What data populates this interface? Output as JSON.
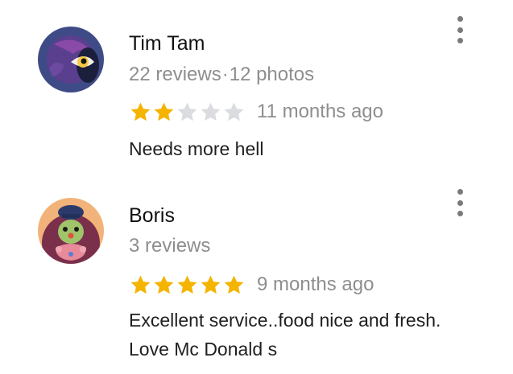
{
  "reviews": [
    {
      "author": "Tim Tam",
      "reviews_count": "22 reviews",
      "separator": "·",
      "photos_count": "12 photos",
      "rating": 2,
      "max_rating": 5,
      "time": "11 months ago",
      "text": "Needs more hell",
      "avatar_icon": "crescent-moon-eye-avatar"
    },
    {
      "author": "Boris",
      "reviews_count": "3 reviews",
      "rating": 5,
      "max_rating": 5,
      "time": "9 months ago",
      "text": "Excellent service..food nice and fresh. Love Mc Donald s",
      "avatar_icon": "clown-character-avatar"
    }
  ],
  "colors": {
    "star_filled": "#f4b400",
    "star_empty": "#dadce0",
    "meta_text": "#8e8e8e",
    "menu_dots": "#7a7a7a"
  }
}
